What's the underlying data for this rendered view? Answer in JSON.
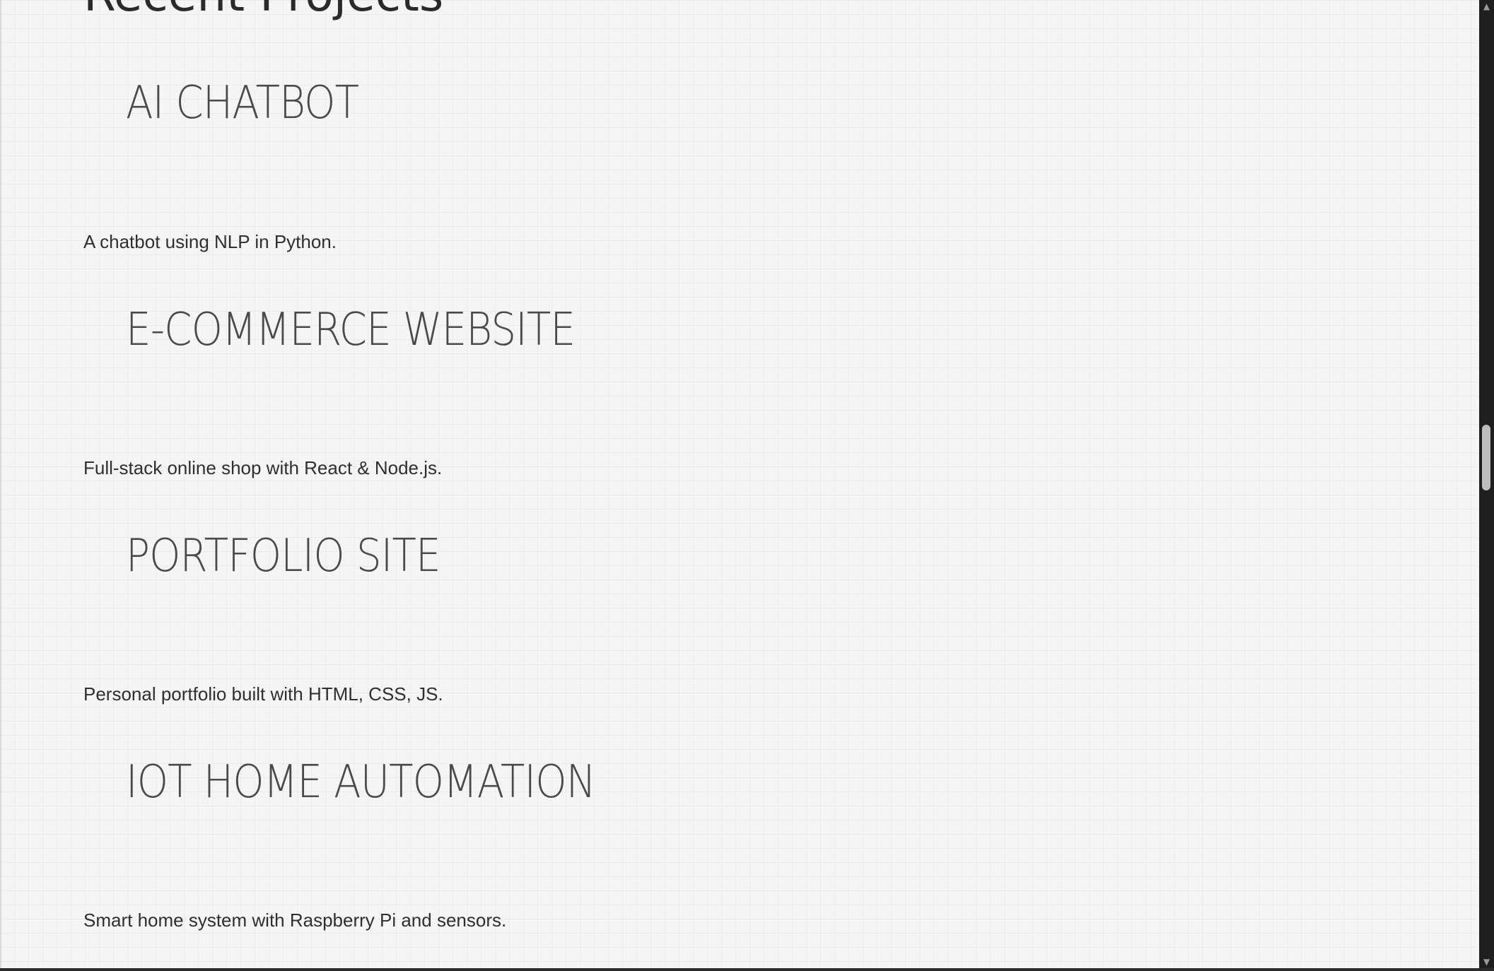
{
  "page": {
    "section_title": "Recent Projects"
  },
  "projects": [
    {
      "title": "AI CHATBOT",
      "description": "A chatbot using NLP in Python."
    },
    {
      "title": "E-COMMERCE WEBSITE",
      "description": "Full-stack online shop with React & Node.js."
    },
    {
      "title": "PORTFOLIO SITE",
      "description": "Personal portfolio built with HTML, CSS, JS."
    },
    {
      "title": "IOT HOME AUTOMATION",
      "description": "Smart home system with Raspberry Pi and sensors."
    }
  ],
  "scrollbar": {
    "up_icon": "triangle-up",
    "down_icon": "triangle-down",
    "position_fraction": 0.47,
    "thumb_fraction": 0.07
  }
}
